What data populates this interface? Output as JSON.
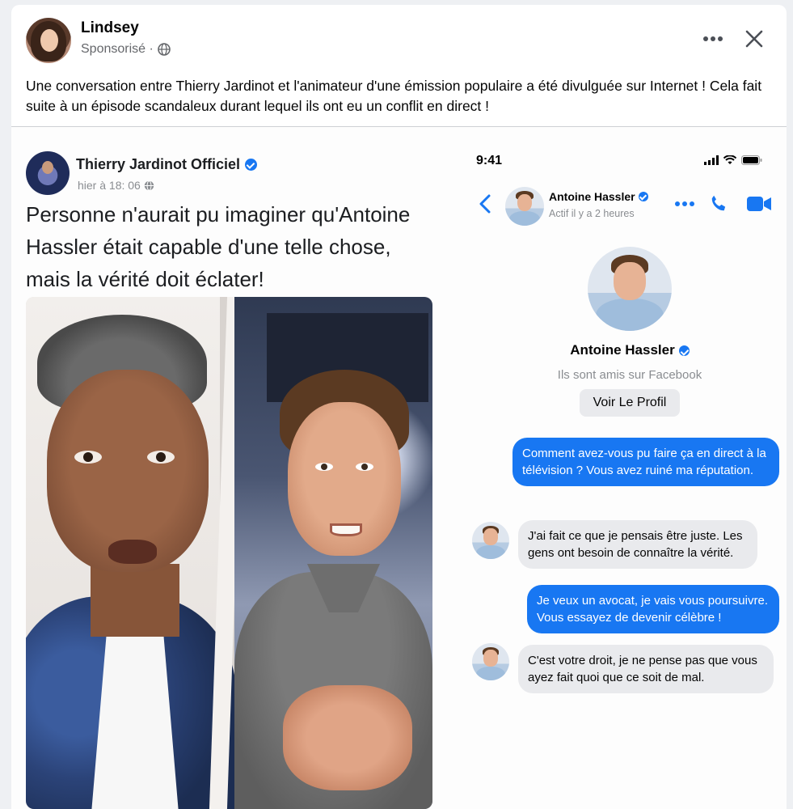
{
  "post": {
    "author": "Lindsey",
    "meta": "Sponsorisé ·",
    "text": "Une conversation entre Thierry Jardinot et l'animateur d'une émission populaire a été divulguée sur Internet ! Cela fait suite à un épisode scandaleux durant lequel ils ont eu un conflit en direct !"
  },
  "inner_post": {
    "author": "Thierry Jardinot Officiel",
    "time": "hier à 18: 06",
    "headline": "Personne n'aurait pu imaginer qu'Antoine Hassler était capable d'une telle chose, mais la vérité doit éclater!"
  },
  "phone": {
    "status_time": "9:41",
    "contact_name": "Antoine Hassler",
    "contact_status": "Actif il y a 2 heures",
    "profile_name": "Antoine Hassler",
    "profile_subtitle": "Ils sont amis sur Facebook",
    "profile_button": "Voir Le Profil",
    "messages": [
      {
        "direction": "out",
        "text": "Comment avez-vous pu faire ça en direct à la télévision ? Vous avez ruiné ma réputation."
      },
      {
        "direction": "in",
        "text": "J'ai fait ce que je pensais être juste. Les gens ont besoin de connaître la vérité."
      },
      {
        "direction": "out",
        "text": "Je veux un avocat, je vais vous poursuivre. Vous essayez de devenir célèbre !"
      },
      {
        "direction": "in",
        "text": "C'est votre droit, je ne pense pas que vous ayez fait quoi que ce soit de mal."
      }
    ]
  },
  "colors": {
    "brand_blue": "#1877f2",
    "incoming_bubble": "#e9eaed",
    "secondary_text": "#65676b"
  },
  "icons": [
    "globe-icon",
    "more-icon",
    "close-icon",
    "verified-icon",
    "back-icon",
    "phone-icon",
    "video-icon",
    "signal-icon",
    "wifi-icon",
    "battery-icon"
  ]
}
